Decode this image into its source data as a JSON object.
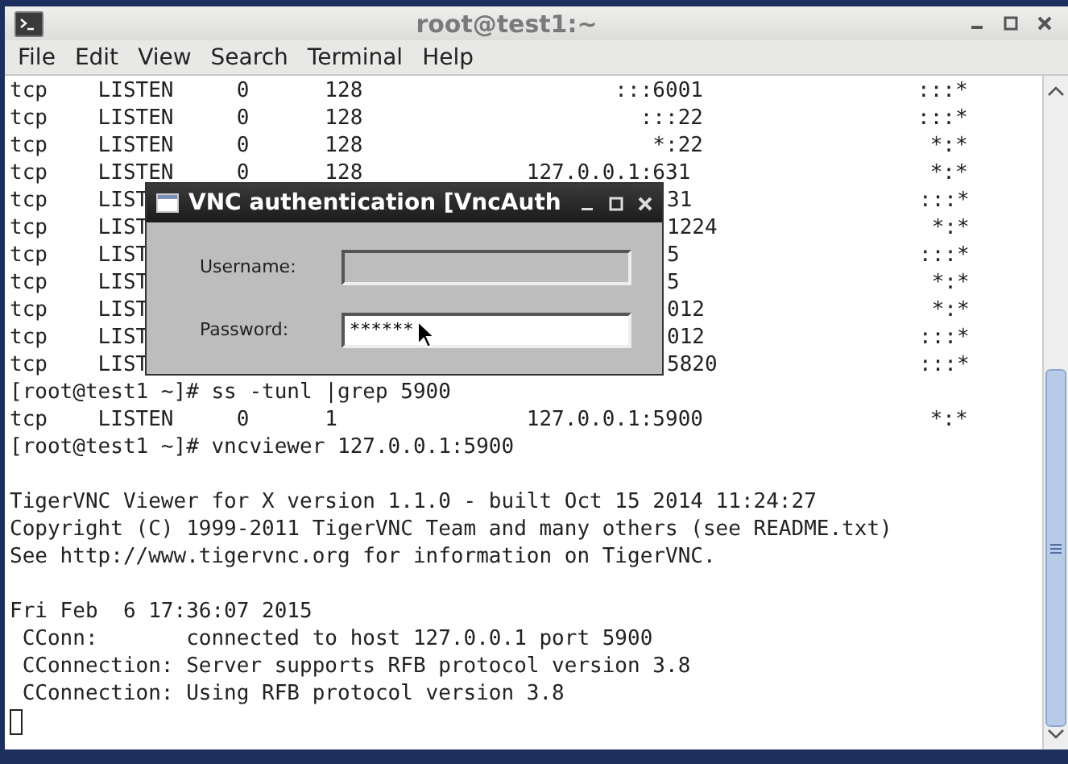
{
  "window": {
    "title": "root@test1:~"
  },
  "menu": [
    "File",
    "Edit",
    "View",
    "Search",
    "Terminal",
    "Help"
  ],
  "terminal": {
    "lines": [
      {
        "kind": "text",
        "text": "tcp    LISTEN     0      128                    :::6001                 :::*"
      },
      {
        "kind": "text",
        "text": "tcp    LISTEN     0      128                      :::22                 :::*"
      },
      {
        "kind": "text",
        "text": "tcp    LISTEN     0      128                       *:22                  *:*"
      },
      {
        "kind": "text",
        "text": "tcp    LISTEN     0      128             127.0.0.1:631                   *:*"
      },
      {
        "kind": "split",
        "left": "tcp    LIST",
        "right": "31                  :::*"
      },
      {
        "kind": "split",
        "left": "tcp    LIST",
        "right": "1224                 *:*"
      },
      {
        "kind": "split",
        "left": "tcp    LIST",
        "right": "5                   :::*"
      },
      {
        "kind": "split",
        "left": "tcp    LIST",
        "right": "5                    *:*"
      },
      {
        "kind": "split",
        "left": "tcp    LIST",
        "right": "012                  *:*"
      },
      {
        "kind": "split",
        "left": "tcp    LIST",
        "right": "012                 :::*"
      },
      {
        "kind": "split",
        "left": "tcp    LIST",
        "right": "5820                :::*"
      },
      {
        "kind": "text",
        "text": "[root@test1 ~]# ss -tunl |grep 5900"
      },
      {
        "kind": "text",
        "text": "tcp    LISTEN     0      1               127.0.0.1:5900                  *:*"
      },
      {
        "kind": "text",
        "text": "[root@test1 ~]# vncviewer 127.0.0.1:5900"
      },
      {
        "kind": "blank"
      },
      {
        "kind": "text",
        "text": "TigerVNC Viewer for X version 1.1.0 - built Oct 15 2014 11:24:27"
      },
      {
        "kind": "text",
        "text": "Copyright (C) 1999-2011 TigerVNC Team and many others (see README.txt)"
      },
      {
        "kind": "text",
        "text": "See http://www.tigervnc.org for information on TigerVNC."
      },
      {
        "kind": "blank"
      },
      {
        "kind": "text",
        "text": "Fri Feb  6 17:36:07 2015"
      },
      {
        "kind": "text",
        "text": " CConn:       connected to host 127.0.0.1 port 5900"
      },
      {
        "kind": "text",
        "text": " CConnection: Server supports RFB protocol version 3.8"
      },
      {
        "kind": "text",
        "text": " CConnection: Using RFB protocol version 3.8"
      },
      {
        "kind": "cursor"
      }
    ]
  },
  "dialog": {
    "title": "VNC authentication [VncAuth",
    "fields": [
      {
        "label": "Username:",
        "disabled": true
      },
      {
        "label": "Password:",
        "value": "******",
        "disabled": false
      }
    ]
  }
}
